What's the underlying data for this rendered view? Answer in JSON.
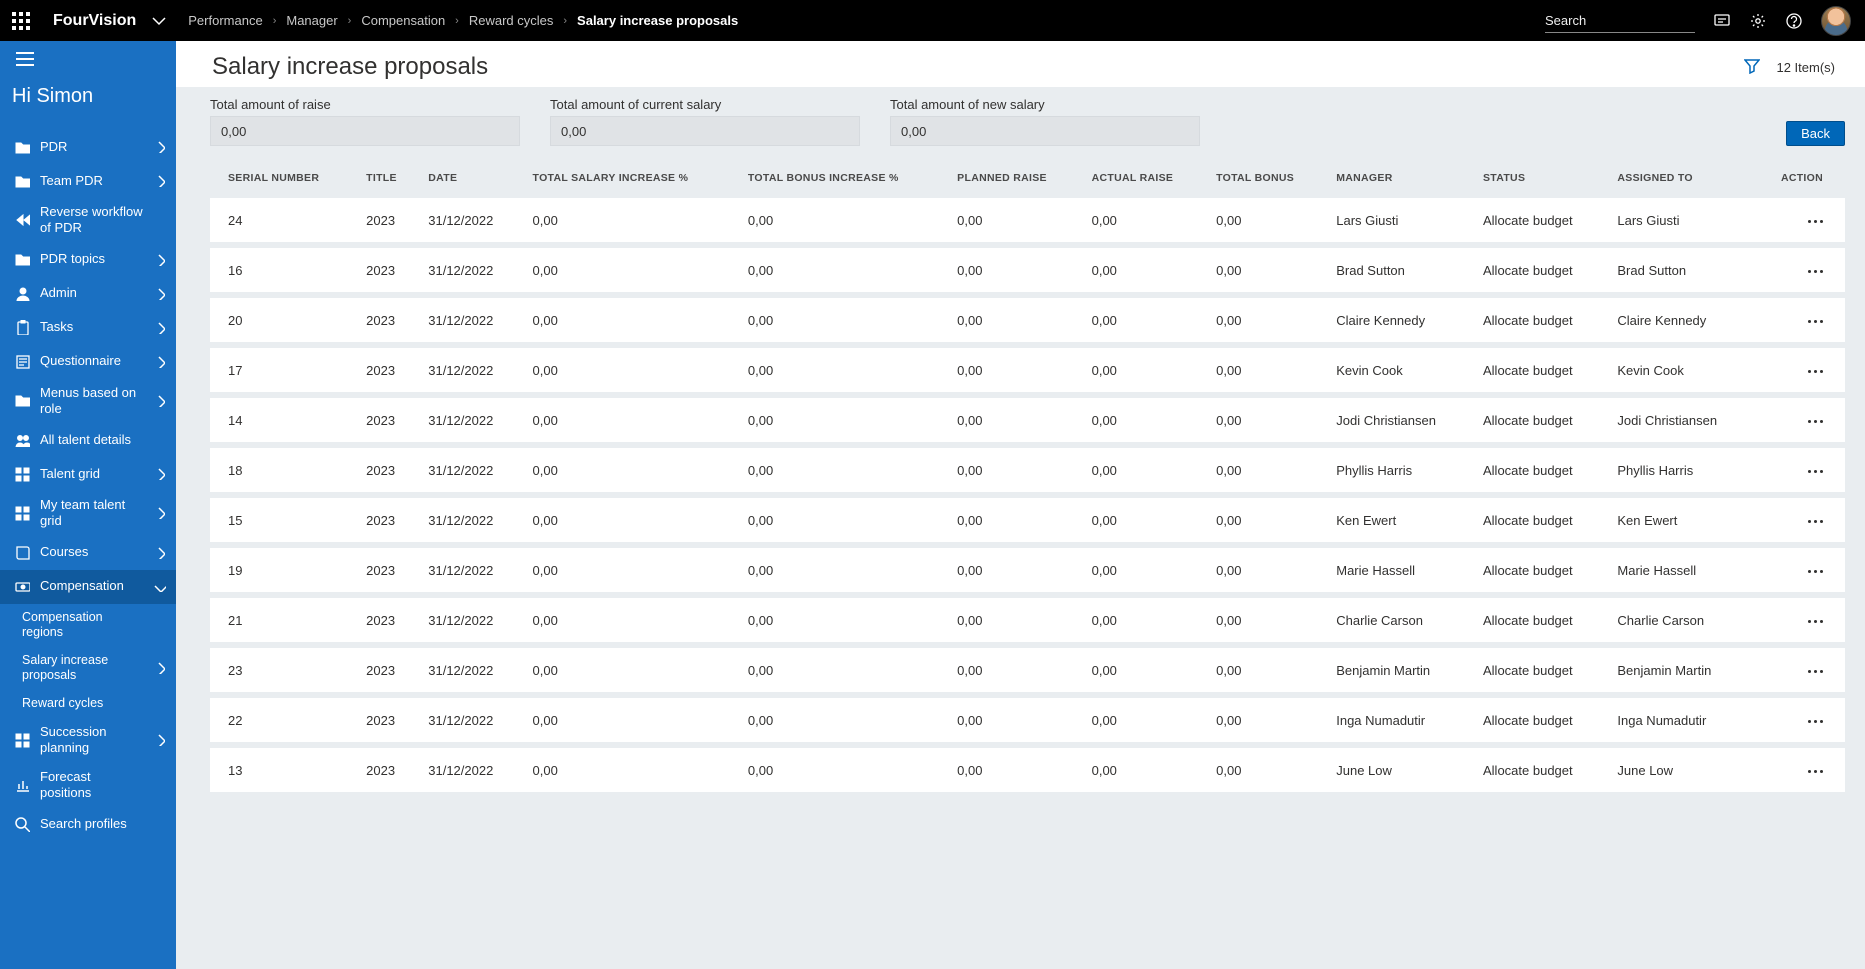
{
  "brand": "FourVision",
  "search_placeholder": "Search",
  "greeting": "Hi Simon",
  "breadcrumbs": [
    "Performance",
    "Manager",
    "Compensation",
    "Reward cycles",
    "Salary increase proposals"
  ],
  "page_title": "Salary increase proposals",
  "item_count_label": "12 Item(s)",
  "back_label": "Back",
  "summary": {
    "raise_label": "Total amount of raise",
    "raise_value": "0,00",
    "current_label": "Total amount of current salary",
    "current_value": "0,00",
    "new_label": "Total amount of new salary",
    "new_value": "0,00"
  },
  "sidebar": {
    "items": [
      {
        "icon": "folder",
        "label": "PDR",
        "exp": "right"
      },
      {
        "icon": "folder",
        "label": "Team PDR",
        "exp": "right"
      },
      {
        "icon": "rewind",
        "label": "Reverse workflow of PDR",
        "exp": ""
      },
      {
        "icon": "folder",
        "label": "PDR topics",
        "exp": "right"
      },
      {
        "icon": "person",
        "label": "Admin",
        "exp": "right"
      },
      {
        "icon": "clip",
        "label": "Tasks",
        "exp": "right"
      },
      {
        "icon": "form",
        "label": "Questionnaire",
        "exp": "right"
      },
      {
        "icon": "folder",
        "label": "Menus based on role",
        "exp": "right"
      },
      {
        "icon": "people",
        "label": "All talent details",
        "exp": ""
      },
      {
        "icon": "grid",
        "label": "Talent grid",
        "exp": "right"
      },
      {
        "icon": "grid",
        "label": "My team talent grid",
        "exp": "right"
      },
      {
        "icon": "book",
        "label": "Courses",
        "exp": "right"
      },
      {
        "icon": "money",
        "label": "Compensation",
        "exp": "down",
        "active": true
      },
      {
        "icon": "",
        "label": "Compensation regions",
        "sub": true
      },
      {
        "icon": "",
        "label": "Salary increase proposals",
        "sub": true,
        "exp": "right"
      },
      {
        "icon": "",
        "label": "Reward cycles",
        "sub": true
      },
      {
        "icon": "grid",
        "label": "Succession planning",
        "exp": "right"
      },
      {
        "icon": "chart",
        "label": "Forecast positions",
        "exp": ""
      },
      {
        "icon": "search",
        "label": "Search profiles",
        "exp": ""
      }
    ]
  },
  "columns": [
    "SERIAL NUMBER",
    "TITLE",
    "DATE",
    "TOTAL SALARY INCREASE %",
    "TOTAL BONUS INCREASE %",
    "PLANNED RAISE",
    "ACTUAL RAISE",
    "TOTAL BONUS",
    "MANAGER",
    "STATUS",
    "ASSIGNED TO",
    "ACTION"
  ],
  "rows": [
    {
      "serial": "24",
      "title": "2023",
      "date": "31/12/2022",
      "tsi": "0,00",
      "tbi": "0,00",
      "plan": "0,00",
      "act": "0,00",
      "tb": "0,00",
      "mgr": "Lars Giusti",
      "status": "Allocate budget",
      "assigned": "Lars Giusti"
    },
    {
      "serial": "16",
      "title": "2023",
      "date": "31/12/2022",
      "tsi": "0,00",
      "tbi": "0,00",
      "plan": "0,00",
      "act": "0,00",
      "tb": "0,00",
      "mgr": "Brad Sutton",
      "status": "Allocate budget",
      "assigned": "Brad Sutton"
    },
    {
      "serial": "20",
      "title": "2023",
      "date": "31/12/2022",
      "tsi": "0,00",
      "tbi": "0,00",
      "plan": "0,00",
      "act": "0,00",
      "tb": "0,00",
      "mgr": "Claire Kennedy",
      "status": "Allocate budget",
      "assigned": "Claire Kennedy"
    },
    {
      "serial": "17",
      "title": "2023",
      "date": "31/12/2022",
      "tsi": "0,00",
      "tbi": "0,00",
      "plan": "0,00",
      "act": "0,00",
      "tb": "0,00",
      "mgr": "Kevin Cook",
      "status": "Allocate budget",
      "assigned": "Kevin Cook"
    },
    {
      "serial": "14",
      "title": "2023",
      "date": "31/12/2022",
      "tsi": "0,00",
      "tbi": "0,00",
      "plan": "0,00",
      "act": "0,00",
      "tb": "0,00",
      "mgr": "Jodi Christiansen",
      "status": "Allocate budget",
      "assigned": "Jodi Christiansen"
    },
    {
      "serial": "18",
      "title": "2023",
      "date": "31/12/2022",
      "tsi": "0,00",
      "tbi": "0,00",
      "plan": "0,00",
      "act": "0,00",
      "tb": "0,00",
      "mgr": "Phyllis Harris",
      "status": "Allocate budget",
      "assigned": "Phyllis Harris"
    },
    {
      "serial": "15",
      "title": "2023",
      "date": "31/12/2022",
      "tsi": "0,00",
      "tbi": "0,00",
      "plan": "0,00",
      "act": "0,00",
      "tb": "0,00",
      "mgr": "Ken Ewert",
      "status": "Allocate budget",
      "assigned": "Ken Ewert"
    },
    {
      "serial": "19",
      "title": "2023",
      "date": "31/12/2022",
      "tsi": "0,00",
      "tbi": "0,00",
      "plan": "0,00",
      "act": "0,00",
      "tb": "0,00",
      "mgr": "Marie Hassell",
      "status": "Allocate budget",
      "assigned": "Marie Hassell"
    },
    {
      "serial": "21",
      "title": "2023",
      "date": "31/12/2022",
      "tsi": "0,00",
      "tbi": "0,00",
      "plan": "0,00",
      "act": "0,00",
      "tb": "0,00",
      "mgr": "Charlie Carson",
      "status": "Allocate budget",
      "assigned": "Charlie Carson"
    },
    {
      "serial": "23",
      "title": "2023",
      "date": "31/12/2022",
      "tsi": "0,00",
      "tbi": "0,00",
      "plan": "0,00",
      "act": "0,00",
      "tb": "0,00",
      "mgr": "Benjamin Martin",
      "status": "Allocate budget",
      "assigned": "Benjamin Martin"
    },
    {
      "serial": "22",
      "title": "2023",
      "date": "31/12/2022",
      "tsi": "0,00",
      "tbi": "0,00",
      "plan": "0,00",
      "act": "0,00",
      "tb": "0,00",
      "mgr": "Inga Numadutir",
      "status": "Allocate budget",
      "assigned": "Inga Numadutir"
    },
    {
      "serial": "13",
      "title": "2023",
      "date": "31/12/2022",
      "tsi": "0,00",
      "tbi": "0,00",
      "plan": "0,00",
      "act": "0,00",
      "tb": "0,00",
      "mgr": "June Low",
      "status": "Allocate budget",
      "assigned": "June Low"
    }
  ]
}
